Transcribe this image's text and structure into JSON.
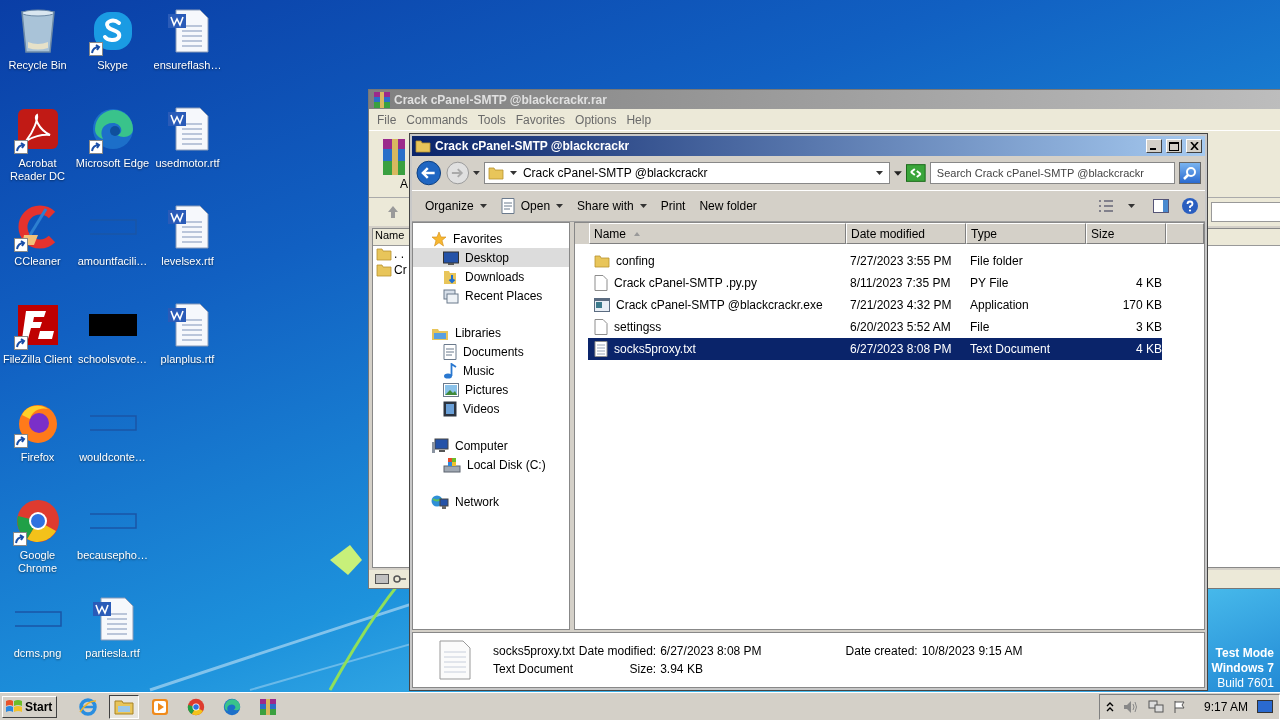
{
  "desktop_icons": [
    {
      "label": "Recycle Bin",
      "kind": "recycle",
      "shortcut": false
    },
    {
      "label": "Acrobat Reader DC",
      "kind": "acrobat",
      "shortcut": true
    },
    {
      "label": "CCleaner",
      "kind": "ccleaner",
      "shortcut": true
    },
    {
      "label": "FileZilla Client",
      "kind": "filezilla",
      "shortcut": true
    },
    {
      "label": "Firefox",
      "kind": "firefox",
      "shortcut": true
    },
    {
      "label": "Google Chrome",
      "kind": "chrome",
      "shortcut": true
    },
    {
      "label": "dcms.png",
      "kind": "blank",
      "shortcut": false
    },
    {
      "label": "Skype",
      "kind": "skype",
      "shortcut": true
    },
    {
      "label": "Microsoft Edge",
      "kind": "edge",
      "shortcut": true
    },
    {
      "label": "amountfacili…",
      "kind": "blank",
      "shortcut": false
    },
    {
      "label": "schoolsvote…",
      "kind": "black",
      "shortcut": false
    },
    {
      "label": "wouldconte…",
      "kind": "blank",
      "shortcut": false
    },
    {
      "label": "becausepho…",
      "kind": "blank",
      "shortcut": false
    },
    {
      "label": "partiesla.rtf",
      "kind": "word",
      "shortcut": false
    },
    {
      "label": "ensureflash…",
      "kind": "word",
      "shortcut": false
    },
    {
      "label": "usedmotor.rtf",
      "kind": "word",
      "shortcut": false
    },
    {
      "label": "levelsex.rtf",
      "kind": "word",
      "shortcut": false
    },
    {
      "label": "planplus.rtf",
      "kind": "word",
      "shortcut": false
    }
  ],
  "archive_window": {
    "title": "Crack cPanel-SMTP @blackcrackr.rar",
    "menu": [
      "File",
      "Commands",
      "Tools",
      "Favorites",
      "Options",
      "Help"
    ],
    "toolbar_label": "A",
    "list_header": "Name",
    "list_items": [
      ". .",
      "Cr"
    ]
  },
  "explorer": {
    "title": "Crack cPanel-SMTP @blackcrackr",
    "address": "Crack cPanel-SMTP @blackcrackr",
    "search": {
      "placeholder": "Search Crack cPanel-SMTP @blackcrackr"
    },
    "toolbar": [
      {
        "label": "Organize",
        "kind": "dropdown"
      },
      {
        "label": "Open",
        "kind": "open"
      },
      {
        "label": "Share with",
        "kind": "dropdown"
      },
      {
        "label": "Print",
        "kind": "plain"
      },
      {
        "label": "New folder",
        "kind": "plain"
      }
    ],
    "nav": [
      {
        "label": "Favorites",
        "kind": "star",
        "selected": false,
        "children": [
          {
            "label": "Desktop",
            "kind": "desktop",
            "selected": true
          },
          {
            "label": "Downloads",
            "kind": "downloads",
            "selected": false
          },
          {
            "label": "Recent Places",
            "kind": "recent",
            "selected": false
          }
        ]
      },
      {
        "label": "Libraries",
        "kind": "library",
        "selected": false,
        "children": [
          {
            "label": "Documents",
            "kind": "documents",
            "selected": false
          },
          {
            "label": "Music",
            "kind": "music",
            "selected": false
          },
          {
            "label": "Pictures",
            "kind": "pictures",
            "selected": false
          },
          {
            "label": "Videos",
            "kind": "videos",
            "selected": false
          }
        ]
      },
      {
        "label": "Computer",
        "kind": "computer",
        "selected": false,
        "children": [
          {
            "label": "Local Disk (C:)",
            "kind": "disk",
            "selected": false
          }
        ]
      },
      {
        "label": "Network",
        "kind": "network",
        "selected": false
      }
    ],
    "columns": [
      "Name",
      "Date modified",
      "Type",
      "Size"
    ],
    "rows": [
      {
        "name": "confing",
        "date": "7/27/2023 3:55 PM",
        "type": "File folder",
        "kind": "folder",
        "selected": false
      },
      {
        "name": "Crack cPanel-SMTP .py.py",
        "date": "8/11/2023 7:35 PM",
        "type": "PY File",
        "size": "4 KB",
        "kind": "file",
        "selected": false
      },
      {
        "name": "Crack cPanel-SMTP @blackcrackr.exe",
        "date": "7/21/2023 4:32 PM",
        "type": "Application",
        "size": "170 KB",
        "kind": "exe",
        "selected": false
      },
      {
        "name": "settingss",
        "date": "6/20/2023 5:52 AM",
        "type": "File",
        "size": "3 KB",
        "kind": "file",
        "selected": false
      },
      {
        "name": "socks5proxy.txt",
        "date": "6/27/2023 8:08 PM",
        "type": "Text Document",
        "size": "4 KB",
        "kind": "text",
        "selected": true
      }
    ],
    "details": {
      "name": "socks5proxy.txt",
      "type": "Text Document",
      "fields": [
        {
          "label": "Date modified:",
          "value": "6/27/2023 8:08 PM"
        },
        {
          "label": "Size:",
          "value": "3.94 KB"
        },
        {
          "label": "Date created:",
          "value": "10/8/2023 9:15 AM"
        }
      ]
    }
  },
  "test_mode": [
    "Test Mode",
    "Windows 7",
    "Build 7601"
  ],
  "taskbar": {
    "start": "Start",
    "apps": [
      {
        "kind": "ie",
        "selected": false
      },
      {
        "kind": "explorer",
        "selected": true
      },
      {
        "kind": "media",
        "selected": false
      },
      {
        "kind": "chrome",
        "selected": false
      },
      {
        "kind": "edge",
        "selected": false
      },
      {
        "kind": "winrar",
        "selected": false
      }
    ],
    "clock": "9:17 AM"
  }
}
